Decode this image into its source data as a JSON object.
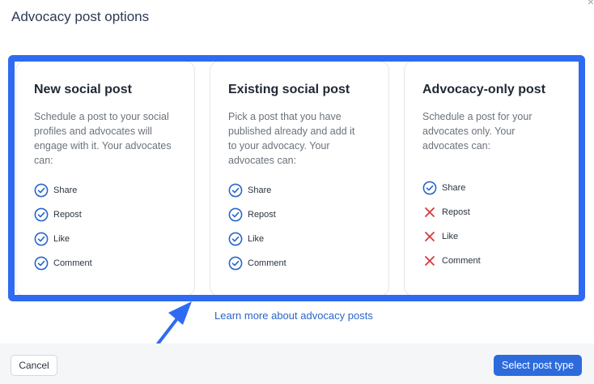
{
  "dialog": {
    "title": "Advocacy post options",
    "close_icon": "close-icon",
    "learn_more": "Learn more about advocacy posts",
    "cancel_label": "Cancel",
    "primary_label": "Select post type"
  },
  "colors": {
    "accent": "#2f6bf2",
    "check": "#2a66c9",
    "cross": "#d9383a",
    "primary_button": "#2d6bdc"
  },
  "cards": [
    {
      "title": "New social post",
      "description": "Schedule a post to your social profiles and advocates will engage with it. Your advocates can:",
      "features": [
        {
          "label": "Share",
          "icon": "check-circle-icon"
        },
        {
          "label": "Repost",
          "icon": "check-circle-icon"
        },
        {
          "label": "Like",
          "icon": "check-circle-icon"
        },
        {
          "label": "Comment",
          "icon": "check-circle-icon"
        }
      ]
    },
    {
      "title": "Existing social post",
      "description": "Pick a post that you have published already and add it to your advocacy. Your advocates can:",
      "features": [
        {
          "label": "Share",
          "icon": "check-circle-icon"
        },
        {
          "label": "Repost",
          "icon": "check-circle-icon"
        },
        {
          "label": "Like",
          "icon": "check-circle-icon"
        },
        {
          "label": "Comment",
          "icon": "check-circle-icon"
        }
      ]
    },
    {
      "title": "Advocacy-only post",
      "description": "Schedule a post for your advocates only. Your advocates can:",
      "features": [
        {
          "label": "Share",
          "icon": "check-circle-icon"
        },
        {
          "label": "Repost",
          "icon": "cross-icon"
        },
        {
          "label": "Like",
          "icon": "cross-icon"
        },
        {
          "label": "Comment",
          "icon": "cross-icon"
        }
      ]
    }
  ]
}
